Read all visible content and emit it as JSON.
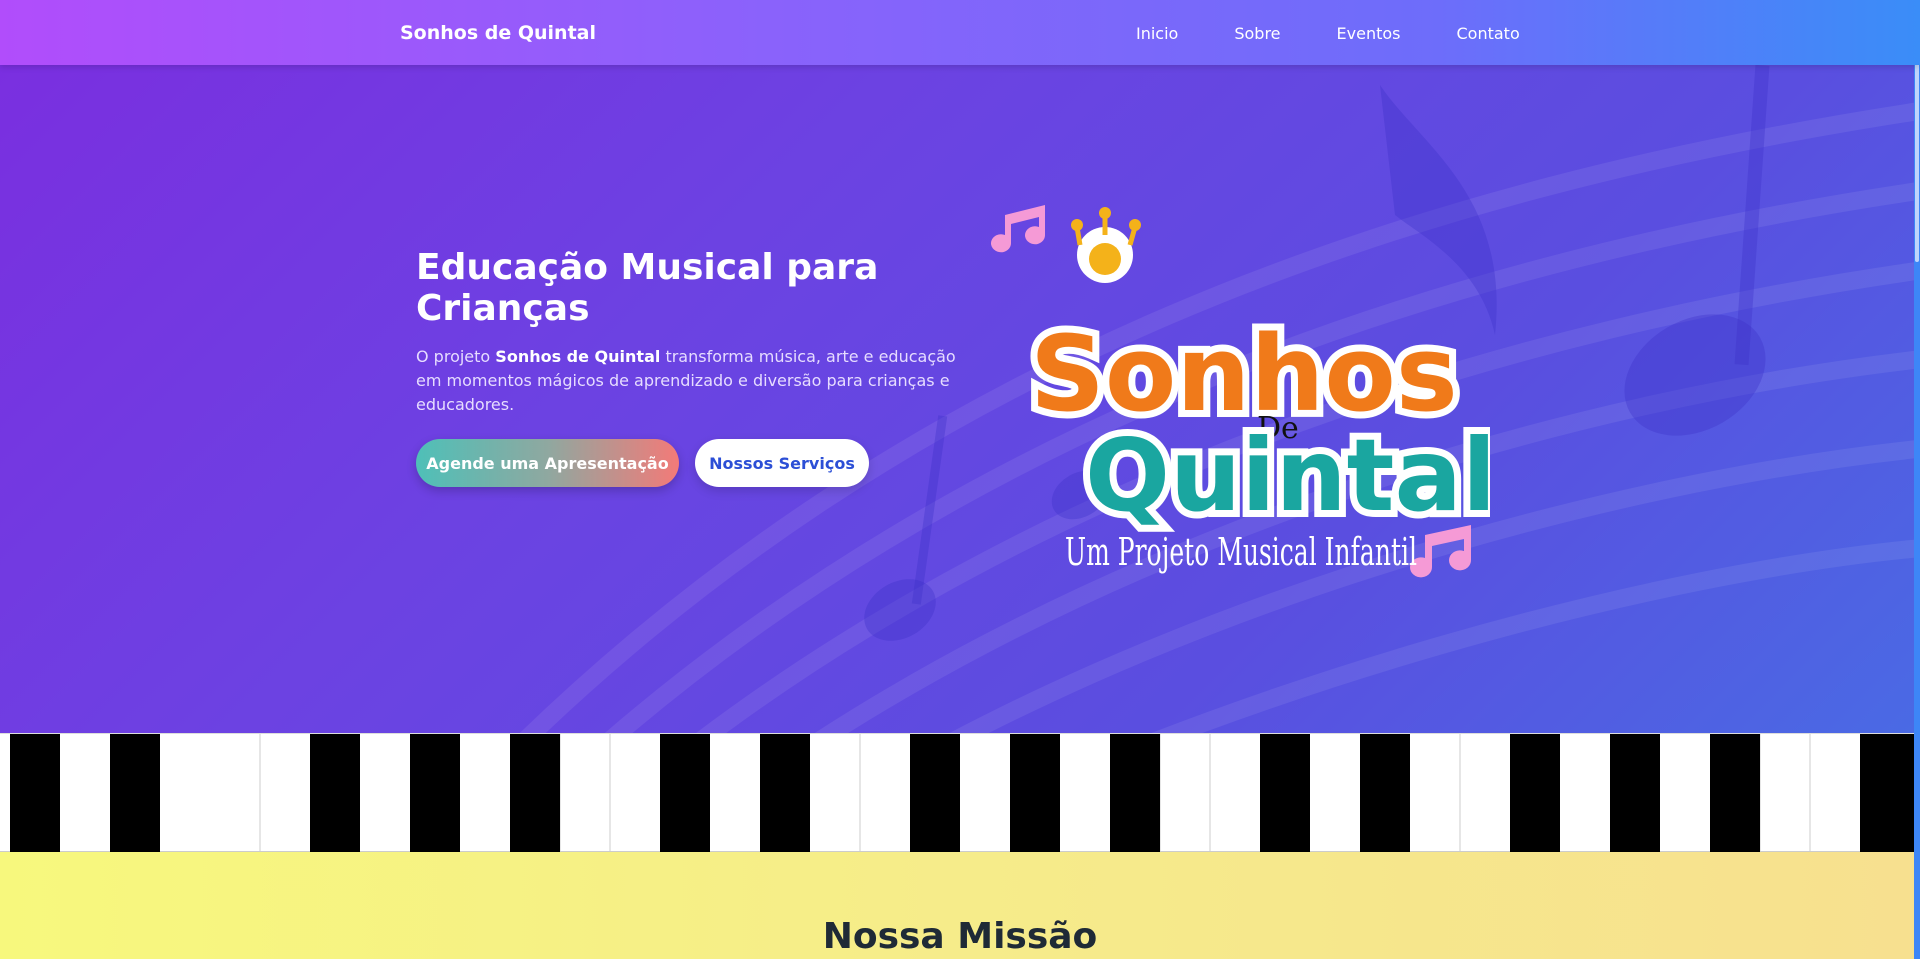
{
  "navbar": {
    "brand": "Sonhos de Quintal",
    "links": [
      {
        "label": "Inicio"
      },
      {
        "label": "Sobre"
      },
      {
        "label": "Eventos"
      },
      {
        "label": "Contato"
      }
    ]
  },
  "hero": {
    "title": "Educação Musical para Crianças",
    "desc_prefix": "O projeto ",
    "desc_bold": "Sonhos de Quintal",
    "desc_suffix": " transforma música, arte e educação em momentos mágicos de aprendizado e diversão para crianças e educadores.",
    "primary_button": "Agende uma Apresentação",
    "secondary_button": "Nossos Serviços"
  },
  "logo": {
    "word1": "Sonhos",
    "word_de": "De",
    "word2": "Quintal",
    "tagline": "Um Projeto Musical Infantil"
  },
  "mission": {
    "title": "Nossa Missão"
  },
  "colors": {
    "nav_start": "#b14dfb",
    "nav_end": "#3a8df8",
    "hero_start": "#7a2fe0",
    "hero_end": "#4a6ae4",
    "logo_orange": "#f07a1a",
    "logo_teal": "#1aa6a0",
    "note_pink": "#f59ad6",
    "secondary_text": "#2c4fd6"
  },
  "icons": [
    "music-note-icon"
  ]
}
